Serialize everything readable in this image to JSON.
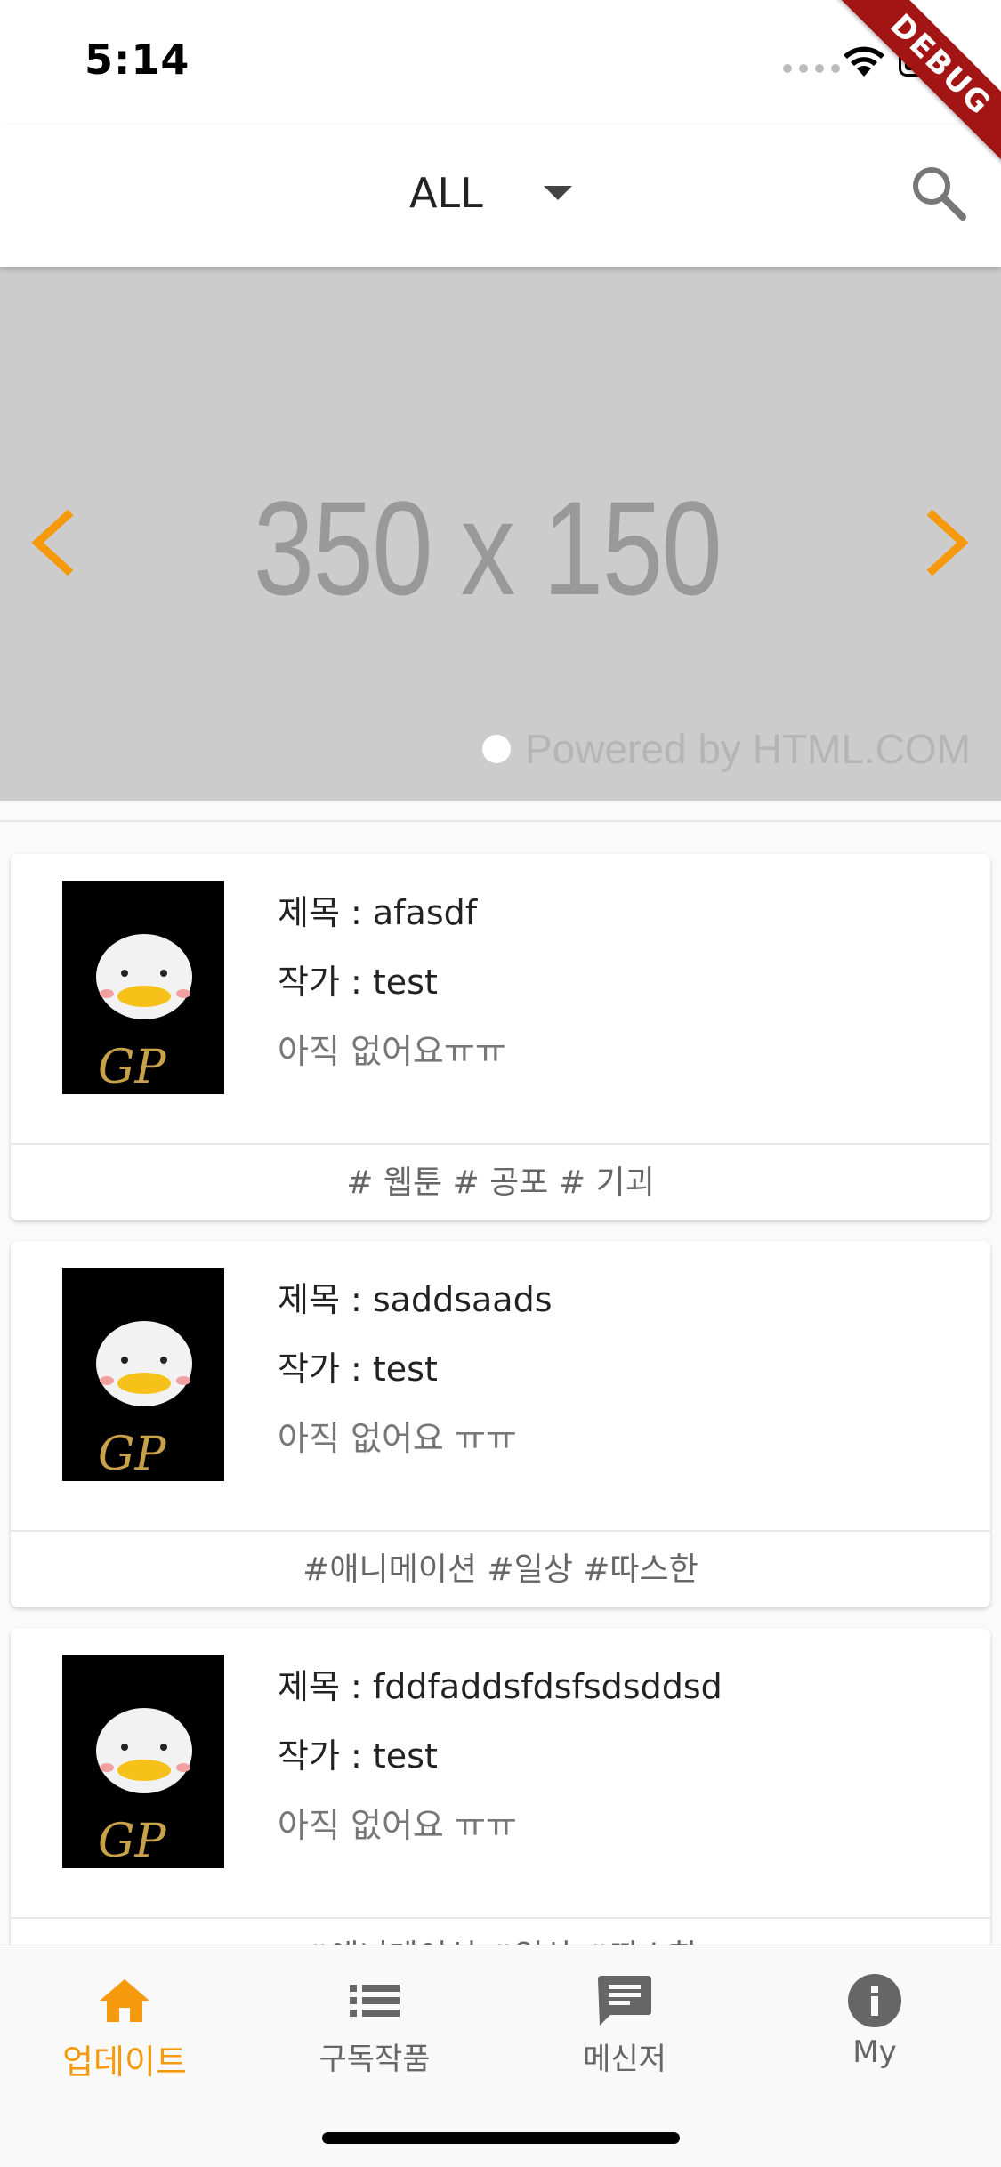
{
  "status_bar": {
    "time": "5:14",
    "debug_label": "DEBUG"
  },
  "header": {
    "filter_label": "ALL",
    "search_icon": "search-icon"
  },
  "banner": {
    "placeholder_text": "350 x 150",
    "powered_text": "Powered by HTML.COM"
  },
  "items": [
    {
      "title": "제목 : afasdf",
      "author": "작가 : test",
      "status": "아직 없어요ㅠㅠ",
      "tags": "# 웹툰 # 공포 # 기괴"
    },
    {
      "title": "제목 : saddsaads",
      "author": "작가 : test",
      "status": "아직 없어요 ㅠㅠ",
      "tags": "#애니메이션 #일상 #따스한"
    },
    {
      "title": "제목 : fddfaddsfdsfsdsddsd",
      "author": "작가 : test",
      "status": "아직 없어요 ㅠㅠ",
      "tags": "#애니메이션 #일상 #따스한"
    }
  ],
  "nav": {
    "items": [
      {
        "label": "업데이트",
        "icon": "home-icon",
        "active": true
      },
      {
        "label": "구독작품",
        "icon": "list-icon",
        "active": false
      },
      {
        "label": "메신저",
        "icon": "chat-icon",
        "active": false
      },
      {
        "label": "My",
        "icon": "info-icon",
        "active": false
      }
    ]
  },
  "colors": {
    "accent": "#f7990c",
    "banner_bg": "#cccccc"
  }
}
